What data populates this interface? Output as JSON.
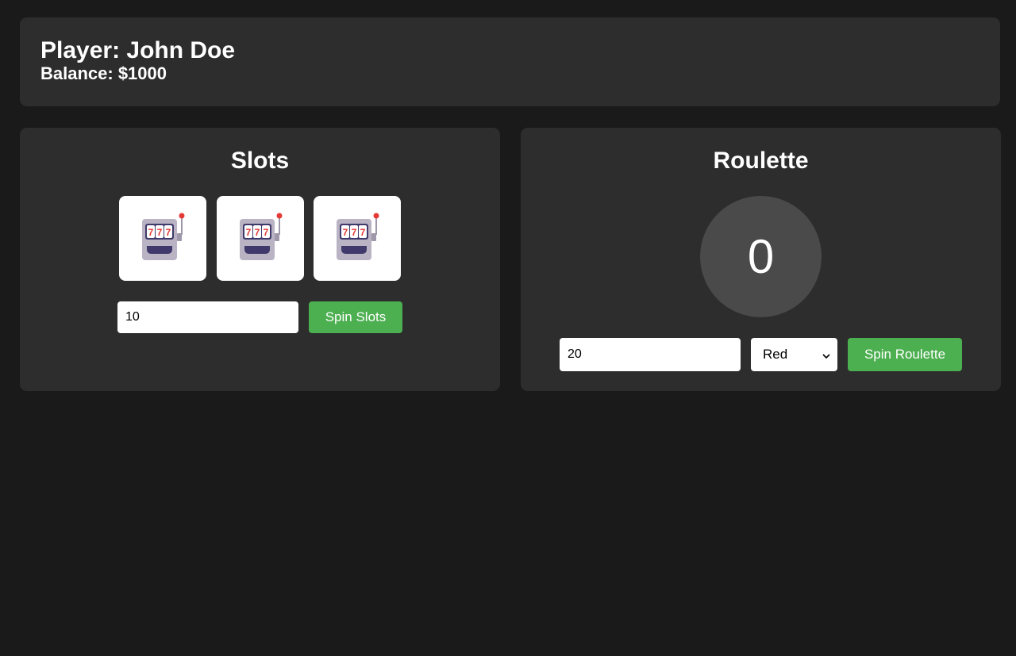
{
  "player": {
    "name_label": "Player: John Doe",
    "balance_label": "Balance: $1000"
  },
  "slots": {
    "title": "Slots",
    "reels": [
      "slot-machine-icon",
      "slot-machine-icon",
      "slot-machine-icon"
    ],
    "bet_value": "10",
    "spin_label": "Spin Slots"
  },
  "roulette": {
    "title": "Roulette",
    "result": "0",
    "bet_value": "20",
    "selected_color": "Red",
    "spin_label": "Spin Roulette"
  },
  "colors": {
    "background": "#1a1a1a",
    "panel": "#2d2d2d",
    "accent_green": "#4caf50",
    "wheel": "#4a4a4a"
  }
}
